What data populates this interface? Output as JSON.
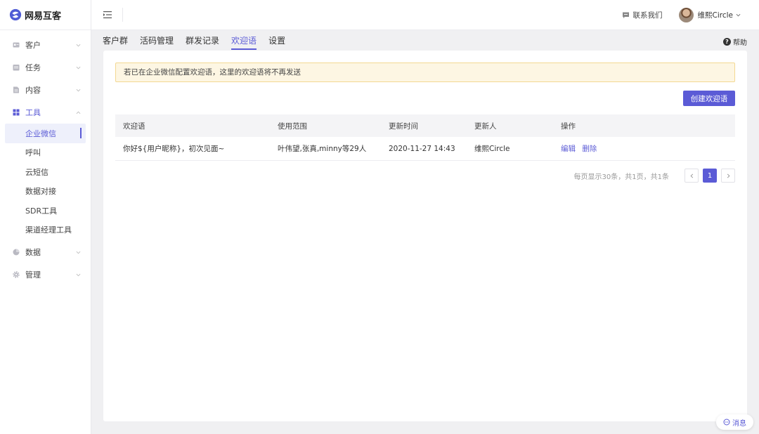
{
  "app": {
    "name": "网易互客"
  },
  "sidebar": {
    "items": [
      {
        "label": "客户",
        "icon": "id-card-icon"
      },
      {
        "label": "任务",
        "icon": "calendar-icon"
      },
      {
        "label": "内容",
        "icon": "document-icon"
      },
      {
        "label": "工具",
        "icon": "grid-icon",
        "expanded": true,
        "children": [
          {
            "label": "企业微信",
            "selected": true
          },
          {
            "label": "呼叫"
          },
          {
            "label": "云短信"
          },
          {
            "label": "数据对接"
          },
          {
            "label": "SDR工具"
          },
          {
            "label": "渠道经理工具"
          }
        ]
      },
      {
        "label": "数据",
        "icon": "pie-chart-icon"
      },
      {
        "label": "管理",
        "icon": "gear-icon"
      }
    ]
  },
  "header": {
    "contact_label": "联系我们",
    "user_name": "维熙Circle"
  },
  "tabs": [
    {
      "label": "客户群"
    },
    {
      "label": "活码管理"
    },
    {
      "label": "群发记录"
    },
    {
      "label": "欢迎语",
      "active": true
    },
    {
      "label": "设置"
    }
  ],
  "help_label": "帮助",
  "notice": "若已在企业微信配置欢迎语，这里的欢迎语将不再发送",
  "create_button": "创建欢迎语",
  "table": {
    "columns": [
      "欢迎语",
      "使用范围",
      "更新时间",
      "更新人",
      "操作"
    ],
    "rows": [
      {
        "greeting": "你好${用户昵称}，初次见面~",
        "scope": "叶伟望,张真,minny等29人",
        "updated_at": "2020-11-27 14:43",
        "updated_by": "维熙Circle",
        "actions": [
          "编辑",
          "删除"
        ]
      }
    ]
  },
  "pagination": {
    "info": "每页显示30条，共1页，共1条",
    "current_page": "1"
  },
  "message_button": "消息",
  "colors": {
    "accent": "#5b5bd6",
    "notice_bg": "#fdf6e3",
    "notice_border": "#f3d892"
  }
}
